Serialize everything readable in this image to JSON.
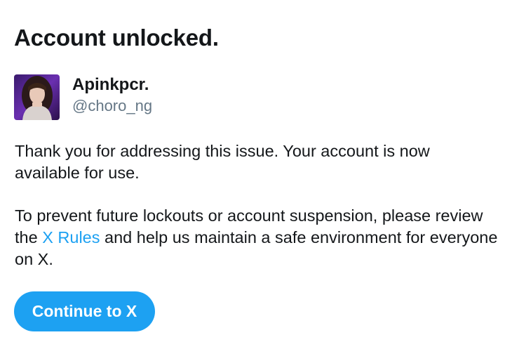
{
  "page": {
    "title": "Account unlocked."
  },
  "profile": {
    "display_name": "Apinkpcr.",
    "handle": "@choro_ng"
  },
  "message": {
    "paragraph1": "Thank you for addressing this issue. Your account is now available for use.",
    "paragraph2_before_link": "To prevent future lockouts or account suspension, please review the ",
    "link_text": "X Rules",
    "paragraph2_after_link": " and help us maintain a safe environment for everyone on X."
  },
  "actions": {
    "continue_label": "Continue to X"
  },
  "colors": {
    "accent": "#1da1f2",
    "text": "#14171a",
    "secondary_text": "#657786",
    "background": "#ffffff"
  }
}
